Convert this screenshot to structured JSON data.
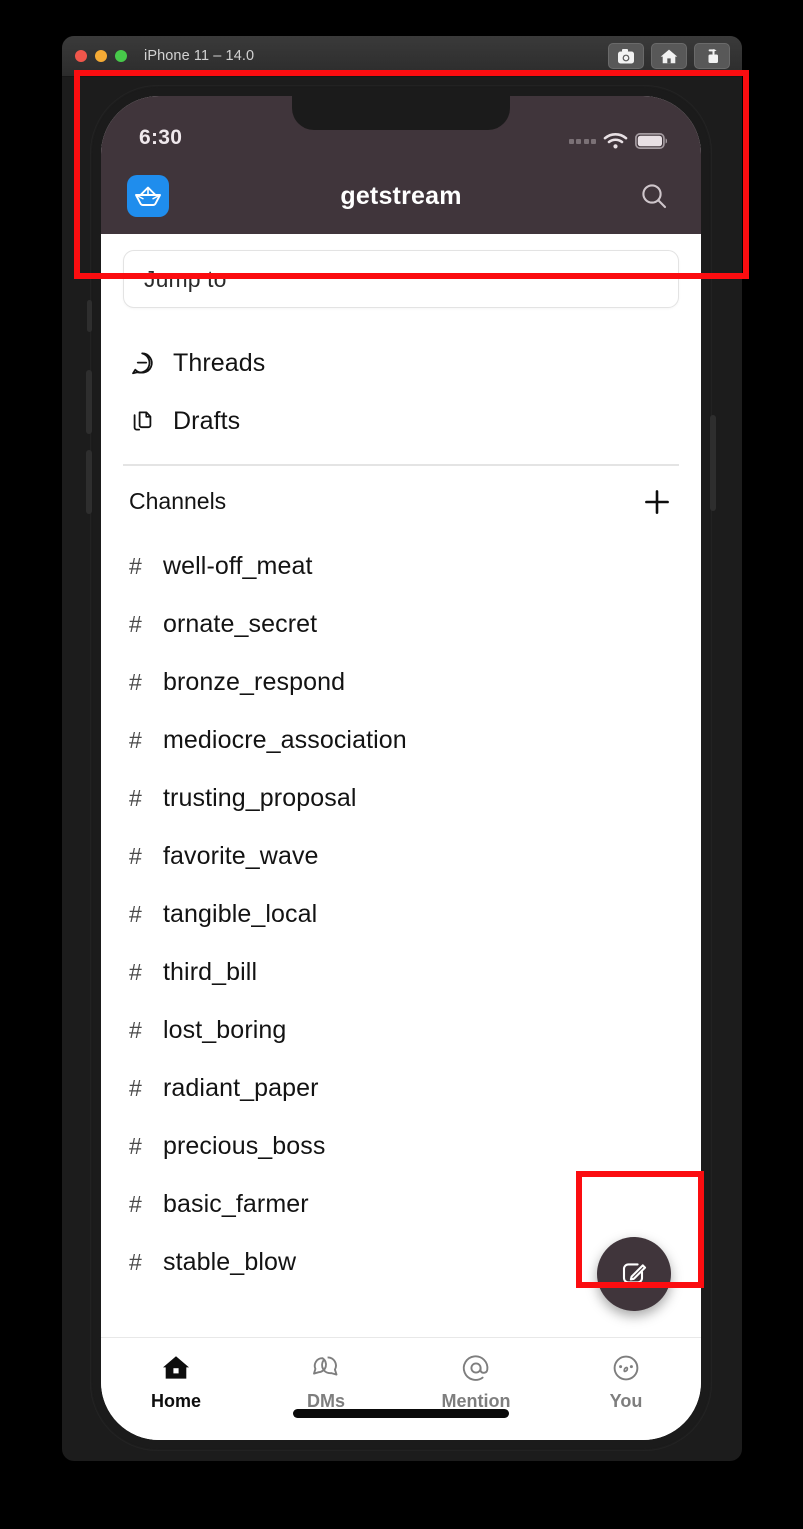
{
  "window": {
    "title": "iPhone 11 – 14.0",
    "traffic_lights": [
      "close",
      "minimize",
      "zoom"
    ],
    "toolbar_buttons": [
      {
        "name": "screenshot-icon",
        "label": "Screenshot"
      },
      {
        "name": "home-icon",
        "label": "Home"
      },
      {
        "name": "share-icon",
        "label": "Share"
      }
    ]
  },
  "status_bar": {
    "time": "6:30",
    "cellular": "cellular-icon",
    "wifi": "wifi-icon",
    "battery": "battery-icon"
  },
  "header": {
    "logo": "getstream-boat-logo",
    "title": "getstream",
    "search": "search-icon",
    "background": "#40353B",
    "logo_color": "#1f8ded"
  },
  "search": {
    "placeholder": "Jump to",
    "value": "Jump to"
  },
  "nav": {
    "items": [
      {
        "label": "Threads",
        "icon": "threads-bubble-icon"
      },
      {
        "label": "Drafts",
        "icon": "drafts-pages-icon"
      }
    ]
  },
  "channels": {
    "section_title": "Channels",
    "add_label": "+",
    "prefix": "#",
    "items": [
      {
        "name": "well-off_meat"
      },
      {
        "name": "ornate_secret"
      },
      {
        "name": "bronze_respond"
      },
      {
        "name": "mediocre_association"
      },
      {
        "name": "trusting_proposal"
      },
      {
        "name": "favorite_wave"
      },
      {
        "name": "tangible_local"
      },
      {
        "name": "third_bill"
      },
      {
        "name": "lost_boring"
      },
      {
        "name": "radiant_paper"
      },
      {
        "name": "precious_boss"
      },
      {
        "name": "basic_farmer"
      },
      {
        "name": "stable_blow"
      }
    ]
  },
  "fab": {
    "name": "compose-button",
    "icon": "compose-pencil-icon",
    "color": "#40353B"
  },
  "tabbar": {
    "items": [
      {
        "label": "Home",
        "icon": "home-icon",
        "active": true
      },
      {
        "label": "DMs",
        "icon": "dms-bubbles-icon",
        "active": false
      },
      {
        "label": "Mention",
        "icon": "mention-at-icon",
        "active": false
      },
      {
        "label": "You",
        "icon": "you-avatar-icon",
        "active": false
      }
    ]
  },
  "annotations": {
    "accent": "#fb0d10",
    "boxes": [
      {
        "name": "header-region-highlight"
      },
      {
        "name": "compose-button-highlight"
      }
    ]
  }
}
